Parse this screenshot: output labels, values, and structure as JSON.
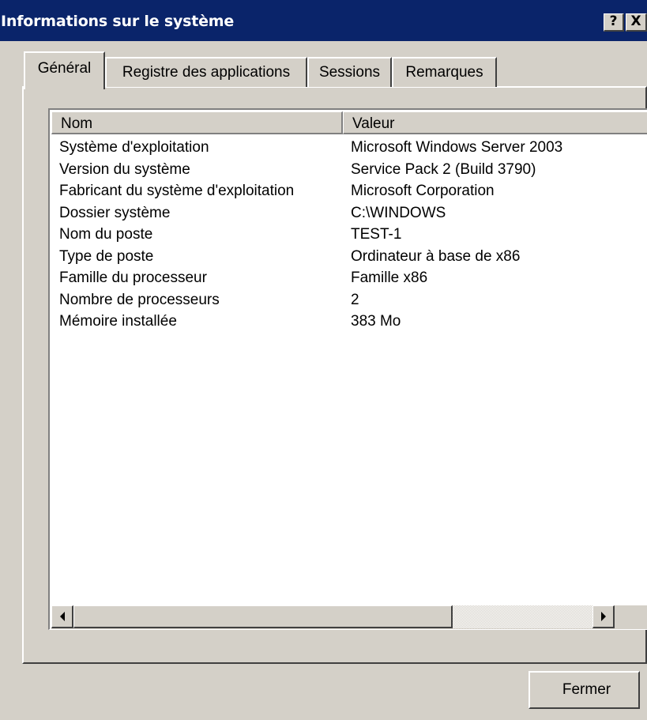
{
  "window": {
    "title": "Informations sur le système",
    "help_label": "?",
    "close_label": "X"
  },
  "tabs": [
    {
      "label": "Général",
      "active": true
    },
    {
      "label": "Registre des applications",
      "active": false
    },
    {
      "label": "Sessions",
      "active": false
    },
    {
      "label": "Remarques",
      "active": false
    }
  ],
  "table": {
    "columns": [
      "Nom",
      "Valeur"
    ],
    "rows": [
      {
        "nom": "Système d'exploitation",
        "valeur": "Microsoft Windows Server 2003"
      },
      {
        "nom": "Version du système",
        "valeur": "Service Pack 2 (Build 3790)"
      },
      {
        "nom": "Fabricant du système d'exploitation",
        "valeur": "Microsoft Corporation"
      },
      {
        "nom": "Dossier système",
        "valeur": "C:\\WINDOWS"
      },
      {
        "nom": "Nom du poste",
        "valeur": "TEST-1"
      },
      {
        "nom": "Type de poste",
        "valeur": "Ordinateur à base de x86"
      },
      {
        "nom": "Famille du processeur",
        "valeur": "Famille x86"
      },
      {
        "nom": "Nombre de processeurs",
        "valeur": "2"
      },
      {
        "nom": "Mémoire installée",
        "valeur": "383 Mo"
      }
    ]
  },
  "footer": {
    "close_button_label": "Fermer"
  },
  "colors": {
    "titlebar": "#0a246a",
    "face": "#d4d0c8"
  }
}
